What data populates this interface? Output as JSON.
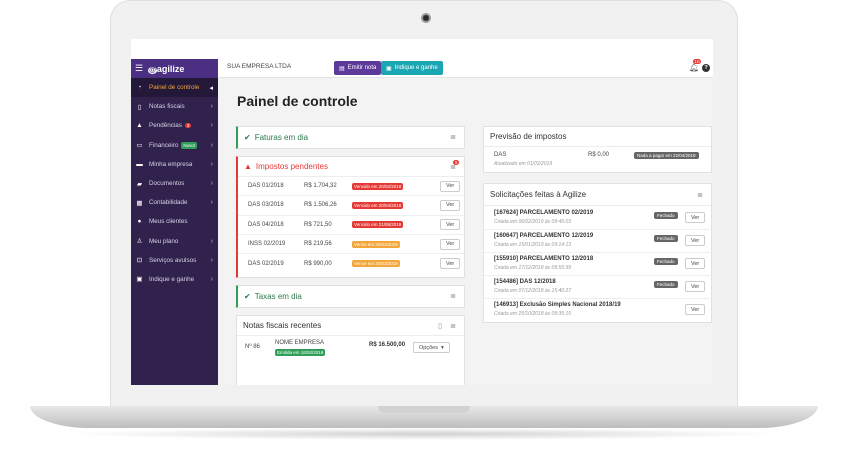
{
  "topbar": {
    "brand": "agilize",
    "company": "SUA EMPRESA LTDA",
    "emitir_label": "Emitir nota",
    "indique_label": "Indique e ganhe",
    "notifications": "10",
    "help": "?"
  },
  "sidebar": {
    "items": [
      {
        "label": "Painel de controle"
      },
      {
        "label": "Notas fiscais"
      },
      {
        "label": "Pendências",
        "badge": "3"
      },
      {
        "label": "Financeiro",
        "badge": "Novo!"
      },
      {
        "label": "Minha empresa"
      },
      {
        "label": "Documentos"
      },
      {
        "label": "Contabilidade"
      },
      {
        "label": "Meus clientes"
      },
      {
        "label": "Meu plano"
      },
      {
        "label": "Serviços avulsos"
      },
      {
        "label": "Indique e ganhe"
      }
    ]
  },
  "main": {
    "title": "Painel de controle",
    "faturas": {
      "title": "Faturas em dia"
    },
    "impostos": {
      "title": "Impostos pendentes",
      "badge": "5",
      "rows": [
        {
          "name": "DAS 01/2018",
          "value": "R$ 1.704,32",
          "status": "Vencido em 20/02/2018",
          "action": "Ver"
        },
        {
          "name": "DAS 03/2018",
          "value": "R$ 1.506,26",
          "status": "Vencido em 20/04/2018",
          "action": "Ver"
        },
        {
          "name": "DAS 04/2018",
          "value": "R$ 721,50",
          "status": "Vencido em 21/05/2018",
          "action": "Ver"
        },
        {
          "name": "INSS 02/2019",
          "value": "R$ 219,56",
          "status": "Vence em 20/03/2019",
          "action": "Ver"
        },
        {
          "name": "DAS 02/2019",
          "value": "R$ 990,00",
          "status": "Vence em 20/03/2019",
          "action": "Ver"
        }
      ]
    },
    "taxas": {
      "title": "Taxas em dia"
    },
    "notas": {
      "title": "Notas fiscais recentes",
      "row": {
        "number": "Nº 86",
        "client": "NOME EMPRESA",
        "status": "Emitida em 16/02/2019",
        "value": "R$ 16.500,00",
        "action": "Opções"
      }
    },
    "previsao": {
      "title": "Previsão de impostos",
      "name": "DAS",
      "value": "R$ 0,00",
      "status": "Nada a pagar em 22/04/2019",
      "updated": "Atualizado em 01/03/2019"
    },
    "solicitacoes": {
      "title": "Solicitações feitas à Agilize",
      "items": [
        {
          "title": "[167624] PARCELAMENTO 02/2019",
          "date": "Criada em 06/02/2019 às 09:45:03",
          "status": "Fechado",
          "action": "Ver"
        },
        {
          "title": "[160647] PARCELAMENTO 12/2019",
          "date": "Criada em 15/01/2019 às 09:14:13",
          "status": "Fechado",
          "action": "Ver"
        },
        {
          "title": "[155910] PARCELAMENTO 12/2018",
          "date": "Criada em 17/12/2018 às 09:55:39",
          "status": "Fechado",
          "action": "Ver"
        },
        {
          "title": "[154486] DAS 12/2018",
          "date": "Criada em 07/12/2018 às 15:40:27",
          "status": "Fechado",
          "action": "Ver"
        },
        {
          "title": "[146913] Exclusão Simples Nacional 2018/19",
          "date": "Criada em 25/10/2018 às 09:35:15",
          "status": "",
          "action": "Ver"
        }
      ]
    }
  },
  "colors": {
    "brand": "#4a2f82",
    "sidebar": "#30224d",
    "accent": "#f4a63a",
    "danger": "#e53935",
    "success": "#2e9e58",
    "teal": "#1aa7b3"
  }
}
